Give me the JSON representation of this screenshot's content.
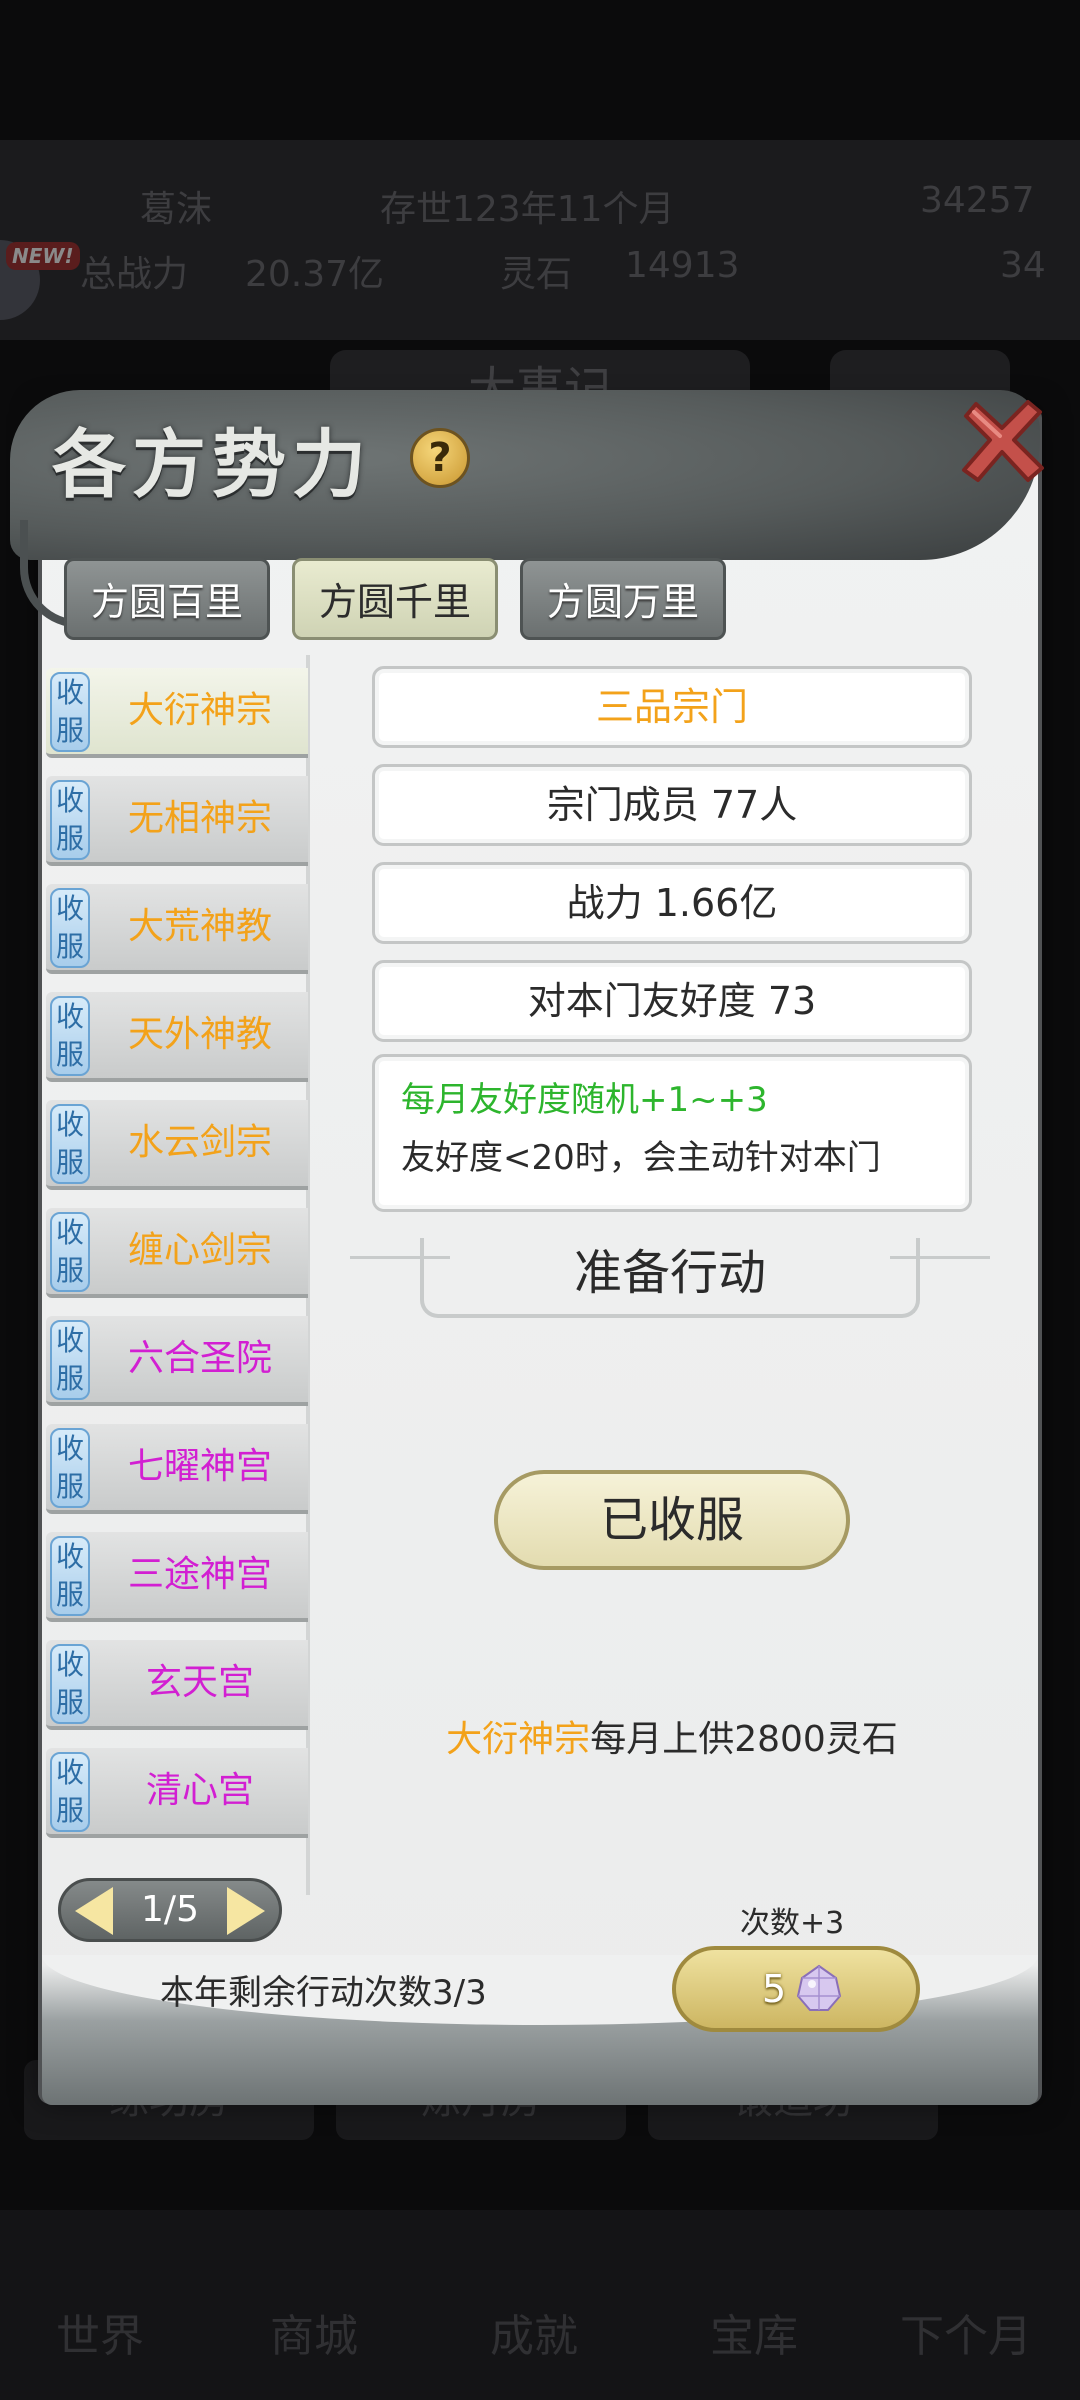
{
  "background": {
    "stats_row1": [
      "葛沫",
      "存世123年11个月",
      "34257"
    ],
    "stats_row2": [
      "总战力",
      "20.37亿",
      "灵石",
      "14913",
      "34"
    ],
    "new_badge": "NEW!",
    "center_title": "大事记",
    "buildings": [
      "练功房",
      "炼丹房",
      "锻造坊"
    ],
    "nav": [
      "世界",
      "商城",
      "成就",
      "宝库",
      "下个月"
    ]
  },
  "panel": {
    "title": "各方势力",
    "help_label": "?",
    "tabs": [
      {
        "label": "方圆百里",
        "active": false
      },
      {
        "label": "方圆千里",
        "active": true
      },
      {
        "label": "方圆万里",
        "active": false
      }
    ],
    "badge_text": "收服",
    "sects": [
      {
        "name": "大衍神宗",
        "color": "#f3a21a",
        "active": true
      },
      {
        "name": "无相神宗",
        "color": "#f3a21a",
        "active": false
      },
      {
        "name": "大荒神教",
        "color": "#f3a21a",
        "active": false
      },
      {
        "name": "天外神教",
        "color": "#f3a21a",
        "active": false
      },
      {
        "name": "水云剑宗",
        "color": "#f3a21a",
        "active": false
      },
      {
        "name": "缠心剑宗",
        "color": "#f3a21a",
        "active": false
      },
      {
        "name": "六合圣院",
        "color": "#d21fd2",
        "active": false
      },
      {
        "name": "七曜神宫",
        "color": "#d21fd2",
        "active": false
      },
      {
        "name": "三途神宫",
        "color": "#d21fd2",
        "active": false
      },
      {
        "name": "玄天宫",
        "color": "#d21fd2",
        "active": false
      },
      {
        "name": "清心宫",
        "color": "#d21fd2",
        "active": false
      }
    ],
    "pager": {
      "text": "1/5"
    },
    "details": {
      "rank": "三品宗门",
      "members": "宗门成员 77人",
      "power": "战力 1.66亿",
      "friendship": "对本门友好度 73",
      "desc_line1": "每月友好度随机+1~+3",
      "desc_line2": "友好度<20时，会主动针对本门"
    },
    "section_heading": "准备行动",
    "status_button": "已收服",
    "tribute": {
      "sect": "大衍神宗",
      "text": "每月上供2800灵石"
    },
    "remaining_actions": "本年剩余行动次数3/3",
    "bonus_label": "次数+3",
    "cost": "5"
  }
}
